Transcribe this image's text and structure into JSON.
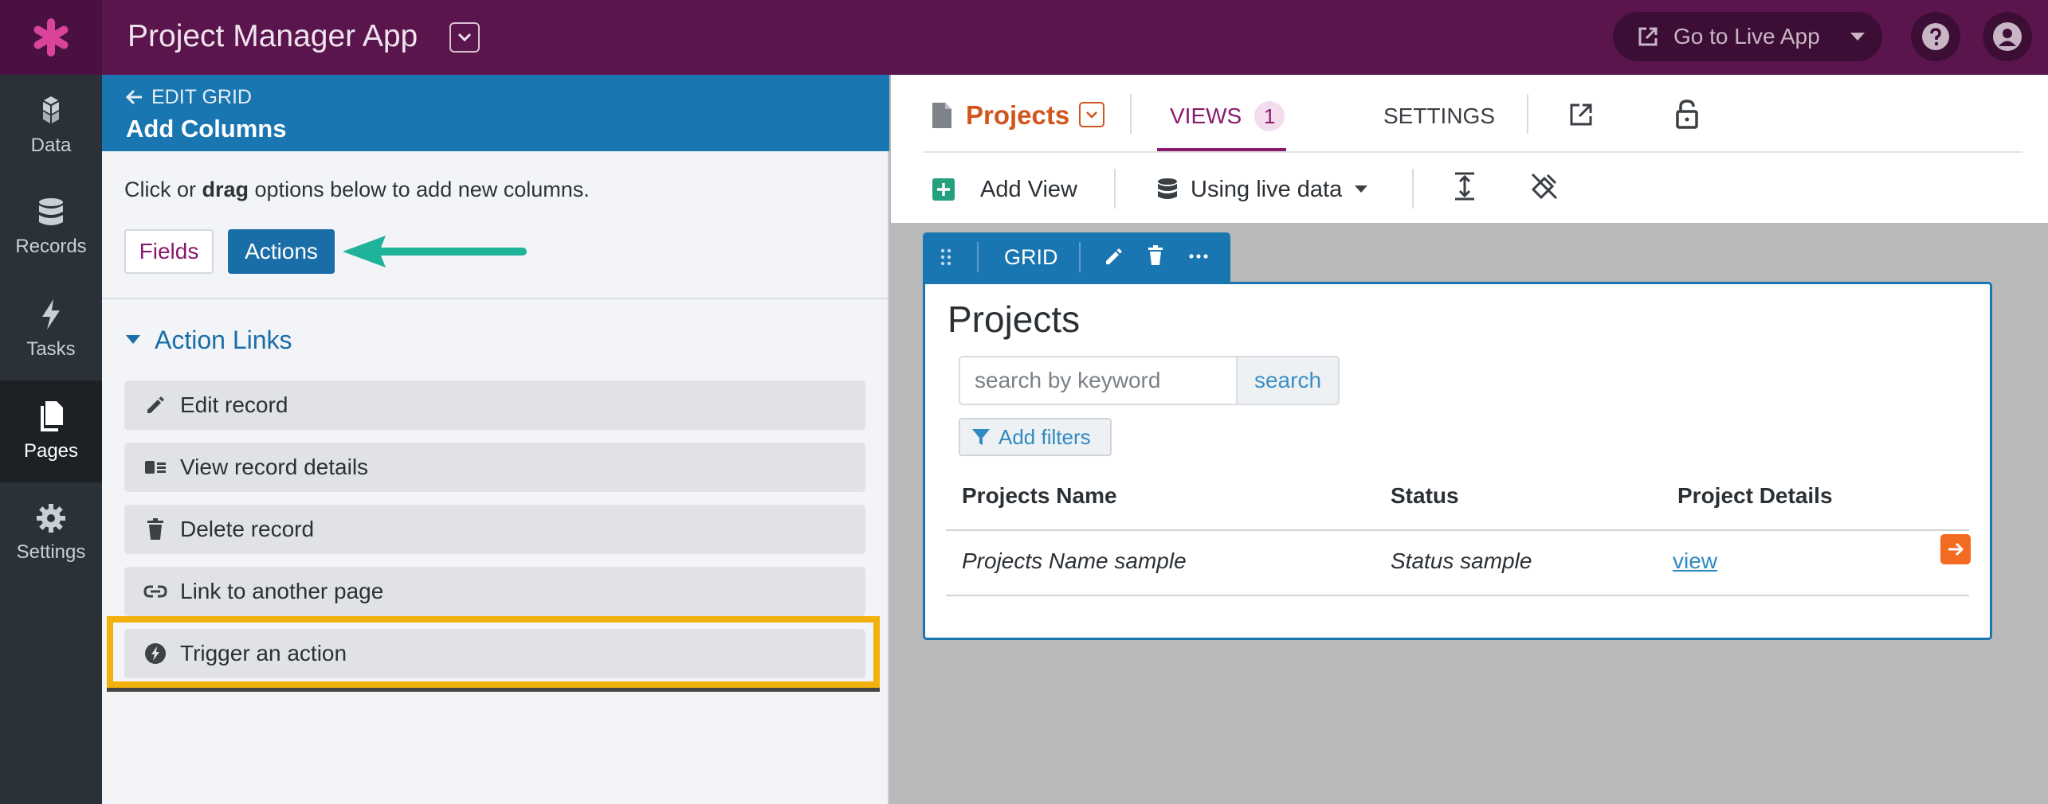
{
  "app": {
    "title": "Project Manager App",
    "go_live_label": "Go to Live App"
  },
  "leftnav": {
    "items": [
      {
        "label": "Data",
        "icon": "cubes-icon"
      },
      {
        "label": "Records",
        "icon": "database-icon"
      },
      {
        "label": "Tasks",
        "icon": "bolt-icon"
      },
      {
        "label": "Pages",
        "icon": "pages-icon",
        "active": true
      },
      {
        "label": "Settings",
        "icon": "gear-icon"
      }
    ]
  },
  "panel": {
    "back_label": "EDIT GRID",
    "title": "Add Columns",
    "instruction_pre": "Click or ",
    "instruction_bold": "drag",
    "instruction_post": " options below to add new columns.",
    "tabs": {
      "fields": "Fields",
      "actions": "Actions",
      "active": "Actions"
    },
    "section_title": "Action Links",
    "actions": [
      {
        "label": "Edit record",
        "icon": "pencil-icon"
      },
      {
        "label": "View record details",
        "icon": "details-icon"
      },
      {
        "label": "Delete record",
        "icon": "trash-icon"
      },
      {
        "label": "Link to another page",
        "icon": "link-icon"
      },
      {
        "label": "Trigger an action",
        "icon": "bolt-circle-icon",
        "highlighted": true
      }
    ]
  },
  "toolbar": {
    "page_name": "Projects",
    "views_label": "VIEWS",
    "views_count": "1",
    "settings_label": "SETTINGS",
    "add_view_label": "Add View",
    "live_data_label": "Using live data"
  },
  "grid_view": {
    "bar_label": "GRID",
    "title": "Projects",
    "search_placeholder": "search by keyword",
    "search_button": "search",
    "filters_label": "Add filters",
    "columns": [
      "Projects Name",
      "Status",
      "Project Details"
    ],
    "row": {
      "name": "Projects Name sample",
      "status": "Status sample",
      "details_link": "view"
    }
  },
  "colors": {
    "topbar": "#5a154d",
    "panel_header": "#1a76b0",
    "highlight": "#f2b10d",
    "annotation_arrow": "#1fb39a",
    "page_name": "#d0561b"
  }
}
